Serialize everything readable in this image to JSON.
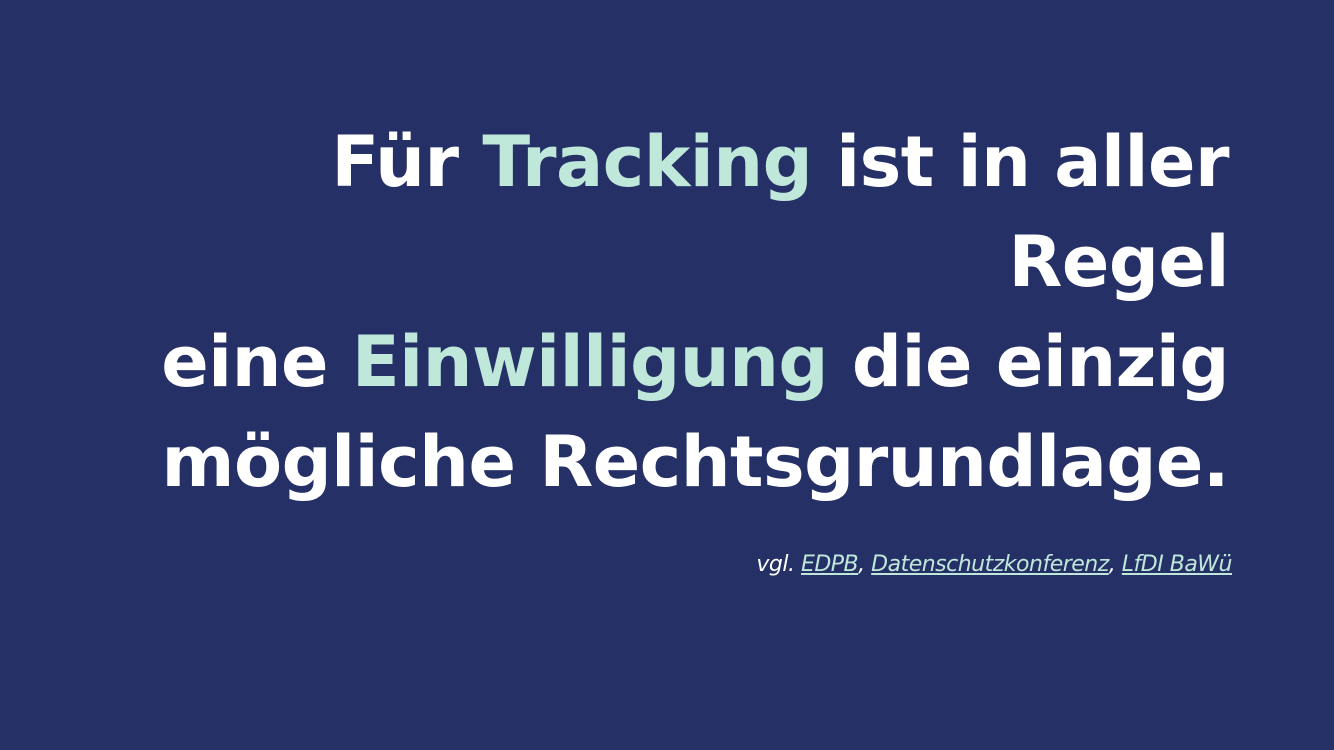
{
  "headline": {
    "line1": {
      "pre": "Für ",
      "accent": "Tracking",
      "post": " ist in aller"
    },
    "line2": "Regel",
    "line3": {
      "pre": "eine ",
      "accent": "Einwilligung",
      "post": " die einzig"
    },
    "line4": "mögliche Rechtsgrundlage."
  },
  "source": {
    "prefix": "vgl. ",
    "links": [
      "EDPB",
      "Datenschutzkonferenz",
      "LfDI BaWü"
    ],
    "separator": ", "
  },
  "colors": {
    "background": "#243066",
    "text": "#ffffff",
    "accent": "#bfe8da"
  }
}
